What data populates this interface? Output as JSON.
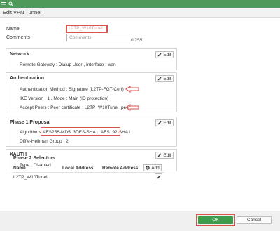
{
  "topbar": {
    "menu_icon": "hamburger-icon",
    "search_icon": "search-icon",
    "color": "#4f9a5a"
  },
  "window_title": "Edit VPN Tunnel",
  "form": {
    "name_label": "Name",
    "name_value": "L2TP_W10Tunel",
    "comments_label": "Comments",
    "comments_placeholder": "Comments",
    "comments_counter": "0/255"
  },
  "network": {
    "title": "Network",
    "edit_label": "Edit",
    "line1": "Remote Gateway : Dialup User , Interface : wan"
  },
  "authentication": {
    "title": "Authentication",
    "edit_label": "Edit",
    "line1": "Authentication Method : Signature (L2TP-FGT-Cert)",
    "line2": "IKE Version : 1 , Mode : Main (ID protection)",
    "line3": "Accept Peers : Peer certificate : L2TP_W10Tunel_peer"
  },
  "phase1": {
    "title": "Phase 1 Proposal",
    "edit_label": "Edit",
    "algorithms_label": "Algorithms",
    "algorithms_value": "AES256-MD5, 3DES-SHA1, AES192-SHA1",
    "dh_line": "Diffie-Hellman Group : 2"
  },
  "xauth": {
    "title": "XAUTH",
    "edit_label": "Edit",
    "line1": "Type : Disabled"
  },
  "phase2": {
    "title": "Phase 2 Selectors",
    "col_name": "Name",
    "col_local": "Local Address",
    "col_remote": "Remote Address",
    "add_label": "Add",
    "rows": [
      {
        "name": "L2TP_W10Tunel"
      }
    ]
  },
  "footer": {
    "ok_label": "OK",
    "cancel_label": "Cancel"
  },
  "colors": {
    "highlight": "#d9534f",
    "ok_green": "#3d9b4a"
  }
}
